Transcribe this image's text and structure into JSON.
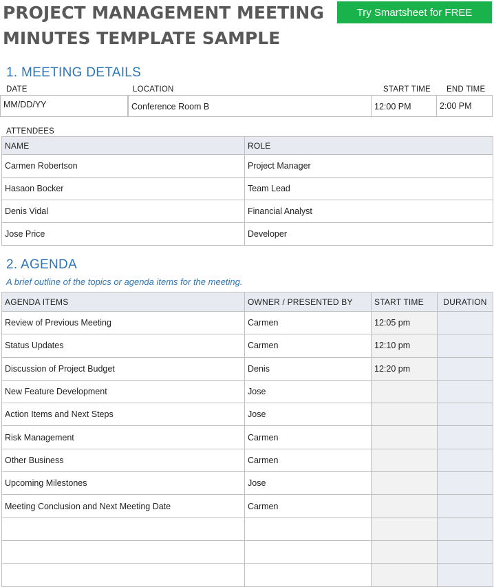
{
  "title": "PROJECT MANAGEMENT MEETING MINUTES TEMPLATE SAMPLE",
  "cta_label": "Try Smartsheet for FREE",
  "cta_color": "#19b24b",
  "accent_color": "#2e75b6",
  "meeting_details": {
    "heading": "1. MEETING DETAILS",
    "labels": {
      "date": "DATE",
      "location": "LOCATION",
      "start_time": "START TIME",
      "end_time": "END TIME"
    },
    "values": {
      "date": "MM/DD/YY",
      "location": "Conference Room B",
      "start_time": "12:00 PM",
      "end_time": "2:00 PM"
    }
  },
  "attendees": {
    "label": "ATTENDEES",
    "headers": {
      "name": "NAME",
      "role": "ROLE"
    },
    "rows": [
      {
        "name": "Carmen Robertson",
        "role": "Project Manager"
      },
      {
        "name": "Hasaon Bocker",
        "role": "Team Lead"
      },
      {
        "name": "Denis Vidal",
        "role": "Financial Analyst"
      },
      {
        "name": "Jose Price",
        "role": "Developer"
      }
    ]
  },
  "agenda": {
    "heading": "2. AGENDA",
    "note": "A brief outline of the topics or agenda items for the meeting.",
    "headers": {
      "item": "AGENDA ITEMS",
      "owner": "OWNER / PRESENTED BY",
      "start": "START TIME",
      "duration": "DURATION"
    },
    "rows": [
      {
        "item": "Review of Previous Meeting",
        "owner": "Carmen",
        "start": "12:05 pm",
        "duration": ""
      },
      {
        "item": "Status Updates",
        "owner": "Carmen",
        "start": "12:10 pm",
        "duration": ""
      },
      {
        "item": "Discussion of Project Budget",
        "owner": "Denis",
        "start": "12:20 pm",
        "duration": ""
      },
      {
        "item": "New Feature Development",
        "owner": "Jose",
        "start": "",
        "duration": ""
      },
      {
        "item": "Action Items and Next Steps",
        "owner": "Jose",
        "start": "",
        "duration": ""
      },
      {
        "item": "Risk Management",
        "owner": "Carmen",
        "start": "",
        "duration": ""
      },
      {
        "item": "Other Business",
        "owner": "Carmen",
        "start": "",
        "duration": ""
      },
      {
        "item": "Upcoming Milestones",
        "owner": "Jose",
        "start": "",
        "duration": ""
      },
      {
        "item": "Meeting Conclusion and Next Meeting Date",
        "owner": "Carmen",
        "start": "",
        "duration": ""
      },
      {
        "item": "",
        "owner": "",
        "start": "",
        "duration": ""
      },
      {
        "item": "",
        "owner": "",
        "start": "",
        "duration": ""
      },
      {
        "item": "",
        "owner": "",
        "start": "",
        "duration": ""
      }
    ]
  }
}
